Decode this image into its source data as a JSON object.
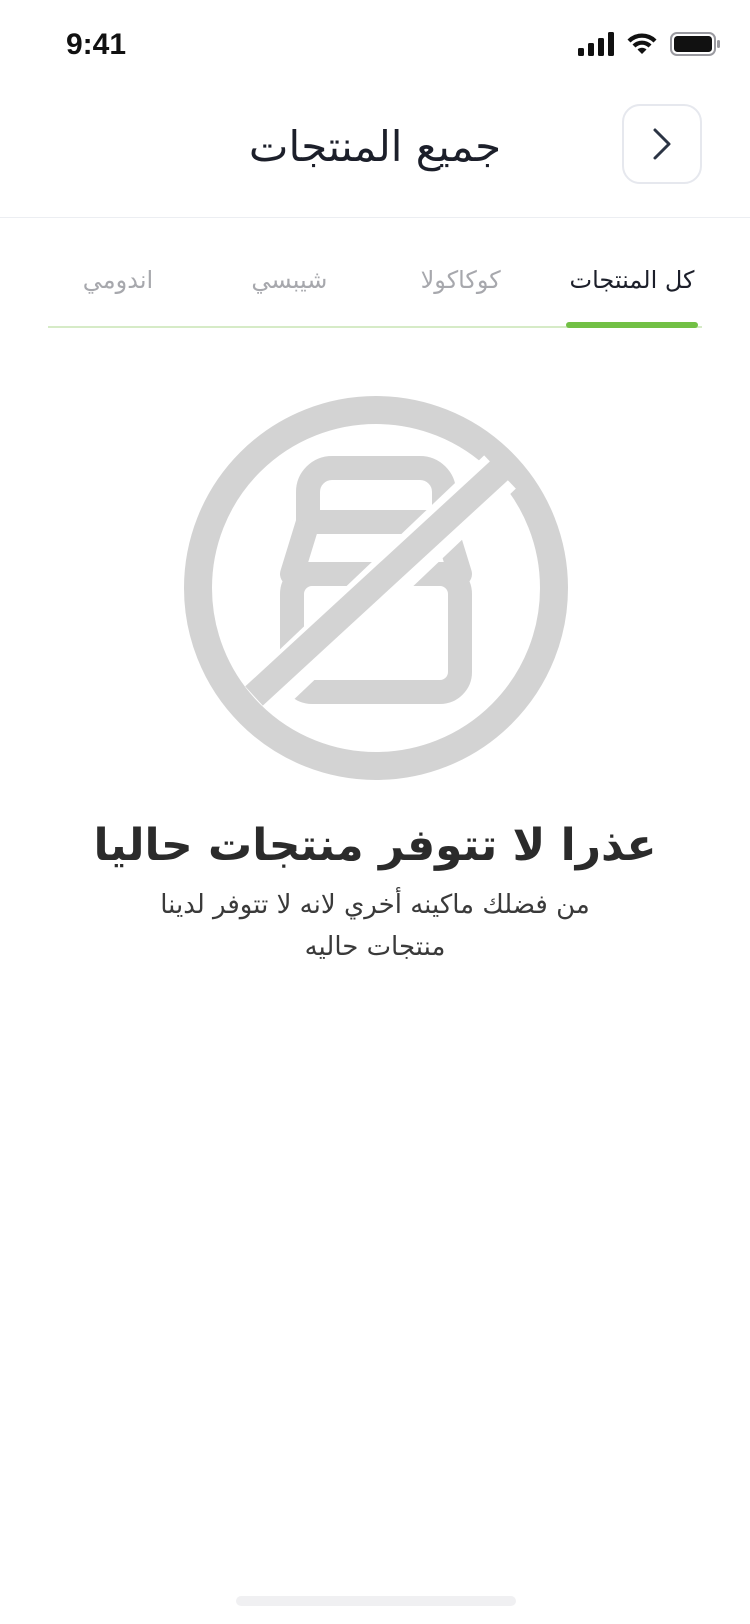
{
  "status_bar": {
    "time": "9:41"
  },
  "header": {
    "title": "جميع المنتجات"
  },
  "tabs": [
    {
      "label": "كل المنتجات",
      "active": true
    },
    {
      "label": "كوكاكولا",
      "active": false
    },
    {
      "label": "شيبسي",
      "active": false
    },
    {
      "label": "اندومي",
      "active": false
    }
  ],
  "empty_state": {
    "title": "عذرا لا تتوفر منتجات حاليا",
    "message": "من فضلك ماكينه أخري لانه لا تتوفر لدينا منتجات حاليه",
    "icon": "no-products-icon"
  },
  "colors": {
    "accent": "#72c045",
    "icon_gray": "#d3d3d3",
    "title_dark": "#1c1f2a"
  }
}
